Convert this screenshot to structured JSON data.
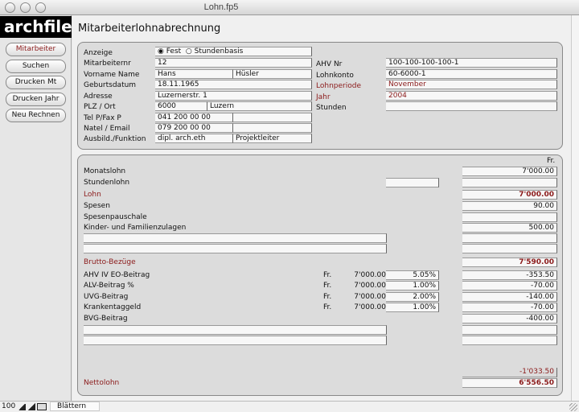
{
  "window": {
    "title": "Lohn.fp5"
  },
  "sidebar": {
    "logo": "archfile",
    "buttons": [
      "Mitarbeiter",
      "Suchen",
      "Drucken Mt",
      "Drucken Jahr",
      "Neu Rechnen"
    ]
  },
  "page": {
    "title": "Mitarbeiterlohnabrechnung"
  },
  "employee": {
    "anzeige_label": "Anzeige",
    "radio_fest": "Fest",
    "radio_stunden": "Stundenbasis",
    "nr_label": "Mitarbeiternr",
    "nr": "12",
    "name_label": "Vorname Name",
    "vorname": "Hans",
    "name": "Hüsler",
    "geb_label": "Geburtsdatum",
    "geb": "18.11.1965",
    "adr_label": "Adresse",
    "adr": "Luzernerstr. 1",
    "plz_label": "PLZ / Ort",
    "plz": "6000",
    "ort": "Luzern",
    "tel_label": "Tel P/Fax P",
    "tel": "041 200 00 00",
    "fax": "",
    "natel_label": "Natel / Email",
    "natel": "079 200 00 00",
    "email": "",
    "ausb_label": "Ausbild./Funktion",
    "ausb": "dipl. arch.eth",
    "funktion": "Projektleiter",
    "ahv_label": "AHV Nr",
    "ahv": "100-100-100-100-1",
    "konto_label": "Lohnkonto",
    "konto": "60-6000-1",
    "periode_label": "Lohnperiode",
    "periode": "November",
    "jahr_label": "Jahr",
    "jahr": "2004",
    "stunden_label": "Stunden",
    "stunden": ""
  },
  "payroll": {
    "currency_header": "Fr.",
    "rows": [
      {
        "label": "Monatslohn",
        "value": "7'000.00"
      },
      {
        "label": "Stundenlohn",
        "value": "",
        "mid": ""
      },
      {
        "label": "Lohn",
        "value": "7'000.00",
        "red": true
      },
      {
        "label": "Spesen",
        "value": "90.00"
      },
      {
        "label": "Spesenpauschale",
        "value": ""
      },
      {
        "label": "Kinder- und Familienzulagen",
        "value": "500.00"
      },
      {
        "blank": true,
        "value": ""
      },
      {
        "blank": true,
        "value": ""
      },
      {
        "label": "Brutto-Bezüge",
        "value": "7'590.00",
        "red": true
      },
      {
        "label": "AHV IV EO-Beitrag",
        "fr": "Fr.",
        "base": "7'000.00",
        "pct": "5.05%",
        "value": "-353.50"
      },
      {
        "label": "ALV-Beitrag %",
        "fr": "Fr.",
        "base": "7'000.00",
        "pct": "1.00%",
        "value": "-70.00"
      },
      {
        "label": "UVG-Beitrag",
        "fr": "Fr.",
        "base": "7'000.00",
        "pct": "2.00%",
        "value": "-140.00"
      },
      {
        "label": "Krankentaggeld",
        "fr": "Fr.",
        "base": "7'000.00",
        "pct": "1.00%",
        "value": "-70.00"
      },
      {
        "label": "BVG-Beitrag",
        "value": "-400.00"
      },
      {
        "blank": true,
        "value": ""
      },
      {
        "blank": true,
        "value": ""
      },
      {
        "value": "-1'033.50",
        "red": true,
        "plain": true
      },
      {
        "label": "Nettolohn",
        "value": "6'556.50",
        "red": true
      }
    ]
  },
  "statusbar": {
    "zoom": "100",
    "mode": "Blättern"
  }
}
